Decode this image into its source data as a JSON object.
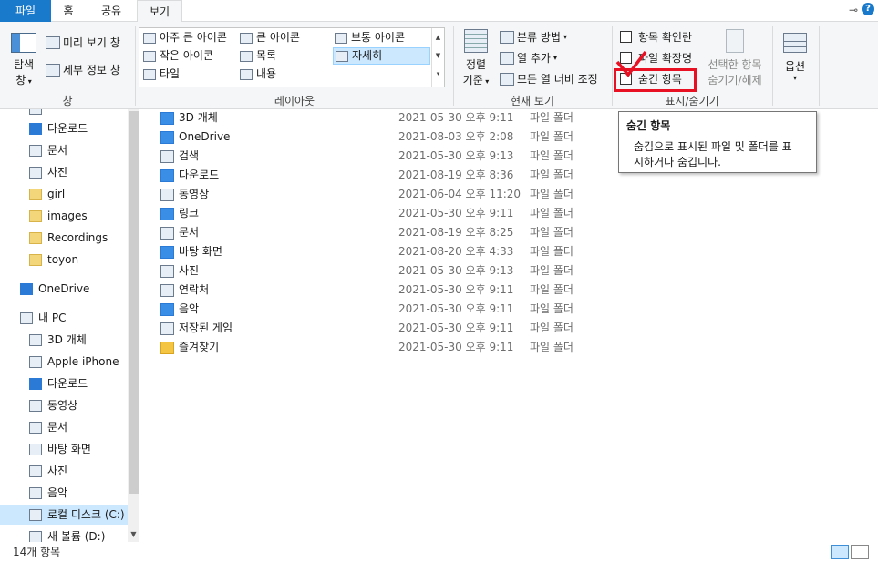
{
  "tabs": {
    "file": "파일",
    "home": "홈",
    "share": "공유",
    "view": "보기"
  },
  "titlebar": {
    "pin_icon": "pin-icon",
    "help_icon": "?"
  },
  "ribbon": {
    "pane": {
      "nav_pane_line1": "탐색",
      "nav_pane_line2": "창",
      "preview": "미리 보기 창",
      "details": "세부 정보 창",
      "label": "창"
    },
    "layout": {
      "items": [
        "아주 큰 아이콘",
        "큰 아이콘",
        "보통 아이콘",
        "작은 아이콘",
        "목록",
        "자세히",
        "타일",
        "내용"
      ],
      "selected": "자세히",
      "label": "레이아웃"
    },
    "current_view": {
      "sort_line1": "정렬",
      "sort_line2": "기준",
      "group_by": "분류 방법",
      "add_column": "열 추가",
      "size_all": "모든 열 너비 조정",
      "label": "현재 보기"
    },
    "show_hide": {
      "item_check": "항목 확인란",
      "extensions": "파일 확장명",
      "hidden_items": "숨긴 항목",
      "hide_selected_line1": "선택한 항목",
      "hide_selected_line2": "숨기기/해제",
      "label": "표시/숨기기"
    },
    "options": {
      "label": "옵션"
    }
  },
  "accent": "#1979ca",
  "highlight_color": "#e81123",
  "tooltip": {
    "title": "숨긴 항목",
    "line1": "숨김으로 표시된 파일 및 폴더를 표",
    "line2": "시하거나 숨깁니다."
  },
  "nav": {
    "items": [
      {
        "label": "다운로드",
        "icon": "download-icon",
        "pinned": true
      },
      {
        "label": "문서",
        "icon": "document-icon",
        "pinned": true
      },
      {
        "label": "사진",
        "icon": "pictures-icon",
        "pinned": true
      },
      {
        "label": "girl",
        "icon": "folder-icon"
      },
      {
        "label": "images",
        "icon": "folder-icon"
      },
      {
        "label": "Recordings",
        "icon": "folder-icon"
      },
      {
        "label": "toyon",
        "icon": "folder-icon"
      },
      {
        "label": "OneDrive",
        "icon": "onedrive-icon"
      },
      {
        "label": "내 PC",
        "icon": "pc-icon"
      },
      {
        "label": "3D 개체",
        "icon": "3d-objects-icon"
      },
      {
        "label": "Apple iPhone",
        "icon": "phone-icon"
      },
      {
        "label": "다운로드",
        "icon": "download-icon"
      },
      {
        "label": "동영상",
        "icon": "video-icon"
      },
      {
        "label": "문서",
        "icon": "document-icon"
      },
      {
        "label": "바탕 화면",
        "icon": "desktop-icon"
      },
      {
        "label": "사진",
        "icon": "pictures-icon"
      },
      {
        "label": "음악",
        "icon": "music-icon"
      },
      {
        "label": "로컬 디스크 (C:)",
        "icon": "drive-icon"
      },
      {
        "label": "새 볼륨 (D:)",
        "icon": "drive-icon"
      }
    ]
  },
  "files": [
    {
      "name": "3D 개체",
      "date": "2021-05-30 오후 9:11",
      "type": "파일 폴더",
      "icon": "3d-objects-icon"
    },
    {
      "name": "OneDrive",
      "date": "2021-08-03 오후 2:08",
      "type": "파일 폴더",
      "icon": "onedrive-icon"
    },
    {
      "name": "검색",
      "date": "2021-05-30 오후 9:13",
      "type": "파일 폴더",
      "icon": "search-icon"
    },
    {
      "name": "다운로드",
      "date": "2021-08-19 오후 8:36",
      "type": "파일 폴더",
      "icon": "download-icon"
    },
    {
      "name": "동영상",
      "date": "2021-06-04 오후 11:20",
      "type": "파일 폴더",
      "icon": "video-icon"
    },
    {
      "name": "링크",
      "date": "2021-05-30 오후 9:11",
      "type": "파일 폴더",
      "icon": "link-icon"
    },
    {
      "name": "문서",
      "date": "2021-08-19 오후 8:25",
      "type": "파일 폴더",
      "icon": "document-icon"
    },
    {
      "name": "바탕 화면",
      "date": "2021-08-20 오후 4:33",
      "type": "파일 폴더",
      "icon": "desktop-icon"
    },
    {
      "name": "사진",
      "date": "2021-05-30 오후 9:13",
      "type": "파일 폴더",
      "icon": "pictures-icon"
    },
    {
      "name": "연락처",
      "date": "2021-05-30 오후 9:11",
      "type": "파일 폴더",
      "icon": "contacts-icon"
    },
    {
      "name": "음악",
      "date": "2021-05-30 오후 9:11",
      "type": "파일 폴더",
      "icon": "music-icon"
    },
    {
      "name": "저장된 게임",
      "date": "2021-05-30 오후 9:11",
      "type": "파일 폴더",
      "icon": "saved-games-icon"
    },
    {
      "name": "즐겨찾기",
      "date": "2021-05-30 오후 9:11",
      "type": "파일 폴더",
      "icon": "favorites-icon"
    }
  ],
  "status": {
    "count": "14개 항목"
  }
}
